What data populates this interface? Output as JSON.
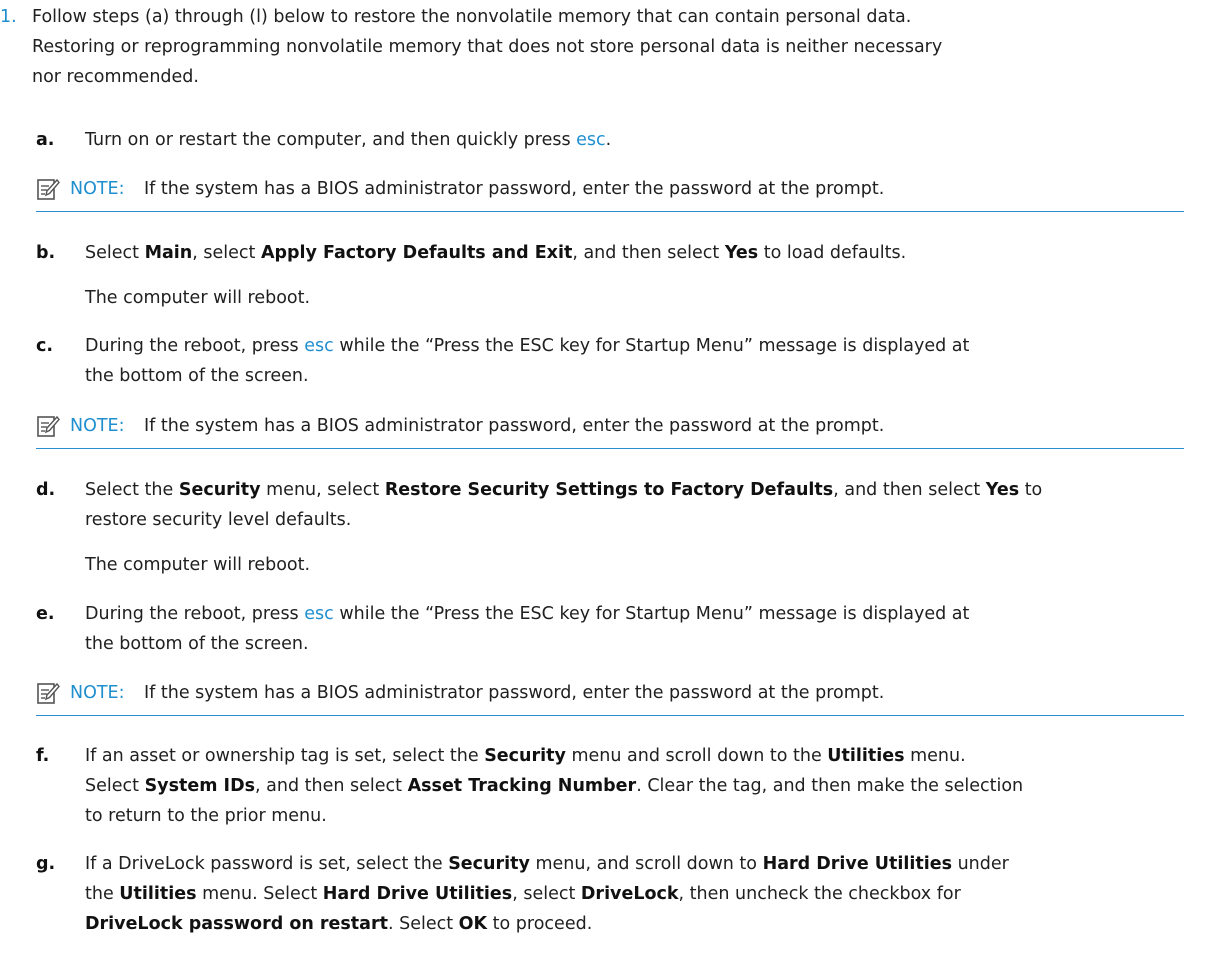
{
  "step1": {
    "number": "1.",
    "lines": [
      "Follow steps (a) through (l) below to restore the nonvolatile memory that can contain personal data.",
      "Restoring or reprogramming nonvolatile memory that does not store personal data is neither necessary",
      "nor recommended."
    ]
  },
  "note": {
    "label": "NOTE:",
    "text": "If the system has a BIOS administrator password, enter the password at the prompt."
  },
  "sub": {
    "a": {
      "letter": "a.",
      "t1": "Turn on or restart the computer, and then quickly press ",
      "key": "esc",
      "t2": "."
    },
    "b": {
      "letter": "b.",
      "t1": "Select ",
      "main": "Main",
      "t2": ", select ",
      "apply": "Apply Factory Defaults and Exit",
      "t3": ", and then select ",
      "yes": "Yes",
      "t4": " to load defaults.",
      "reboot": "The computer will reboot."
    },
    "c": {
      "letter": "c.",
      "t1": "During the reboot, press ",
      "key": "esc",
      "t2": " while the “Press the ESC key for Startup Menu” message is displayed at",
      "line2": "the bottom of the screen."
    },
    "d": {
      "letter": "d.",
      "t1": "Select the ",
      "security": "Security",
      "t2": " menu, select ",
      "restore": "Restore Security Settings to Factory Defaults",
      "t3": ", and then select ",
      "yes": "Yes",
      "t4": " to",
      "line2": "restore security level defaults.",
      "reboot": "The computer will reboot."
    },
    "e": {
      "letter": "e.",
      "t1": "During the reboot, press ",
      "key": "esc",
      "t2": " while the “Press the ESC key for Startup Menu” message is displayed at",
      "line2": "the bottom of the screen."
    },
    "f": {
      "letter": "f.",
      "l1a": "If an asset or ownership tag is set, select the ",
      "l1b": "Security",
      "l1c": " menu and scroll down to the ",
      "l1d": "Utilities",
      "l1e": " menu.",
      "l2a": "Select ",
      "l2b": "System IDs",
      "l2c": ", and then select ",
      "l2d": "Asset Tracking Number",
      "l2e": ". Clear the tag, and then make the selection",
      "l3": "to return to the prior menu."
    },
    "g": {
      "letter": "g.",
      "l1a": "If a DriveLock password is set, select the ",
      "l1b": "Security",
      "l1c": " menu, and scroll down to ",
      "l1d": "Hard Drive Utilities",
      "l1e": " under",
      "l2a": "the ",
      "l2b": "Utilities",
      "l2c": " menu. Select ",
      "l2d": "Hard Drive Utilities",
      "l2e": ", select ",
      "l2f": "DriveLock",
      "l2g": ", then uncheck the checkbox for",
      "l3a": "DriveLock password on restart",
      "l3b": ". Select ",
      "l3c": "OK",
      "l3d": " to proceed."
    }
  }
}
